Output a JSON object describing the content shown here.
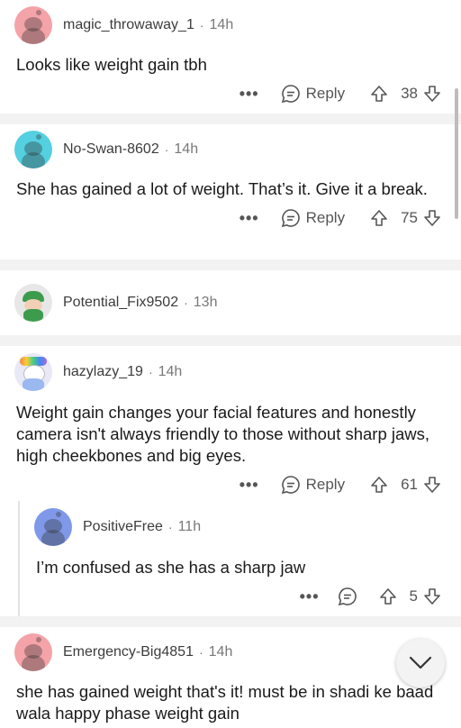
{
  "comments": [
    {
      "user": "magic_throwaway_1",
      "time": "14h",
      "text": "Looks like weight gain tbh",
      "reply": "Reply",
      "votes": "38",
      "avatar_color": "#f4a3a8"
    },
    {
      "user": "No-Swan-8602",
      "time": "14h",
      "text": "She has gained a lot of weight. That’s it. Give it a break.",
      "reply": "Reply",
      "votes": "75",
      "avatar_color": "#54d0e0"
    },
    {
      "user": "Potential_Fix9502",
      "time": "13h",
      "avatar_color": "#e7e7e7"
    },
    {
      "user": "hazylazy_19",
      "time": "14h",
      "text": "Weight gain changes your facial features and honestly camera isn't always friendly to those without sharp jaws, high cheekbones and big eyes.",
      "reply": "Reply",
      "votes": "61",
      "avatar_color": "#e8e8f6"
    },
    {
      "user": "PositiveFree",
      "time": "11h",
      "text": "I’m confused as she has a sharp jaw",
      "votes": "5",
      "avatar_color": "#7f98e8"
    },
    {
      "user": "Emergency-Big4851",
      "time": "14h",
      "text": "she has gained weight that's it! must be in shadi ke baad wala happy phase weight gain",
      "avatar_color": "#f4a3a8"
    }
  ],
  "separator": "·",
  "more": "•••"
}
